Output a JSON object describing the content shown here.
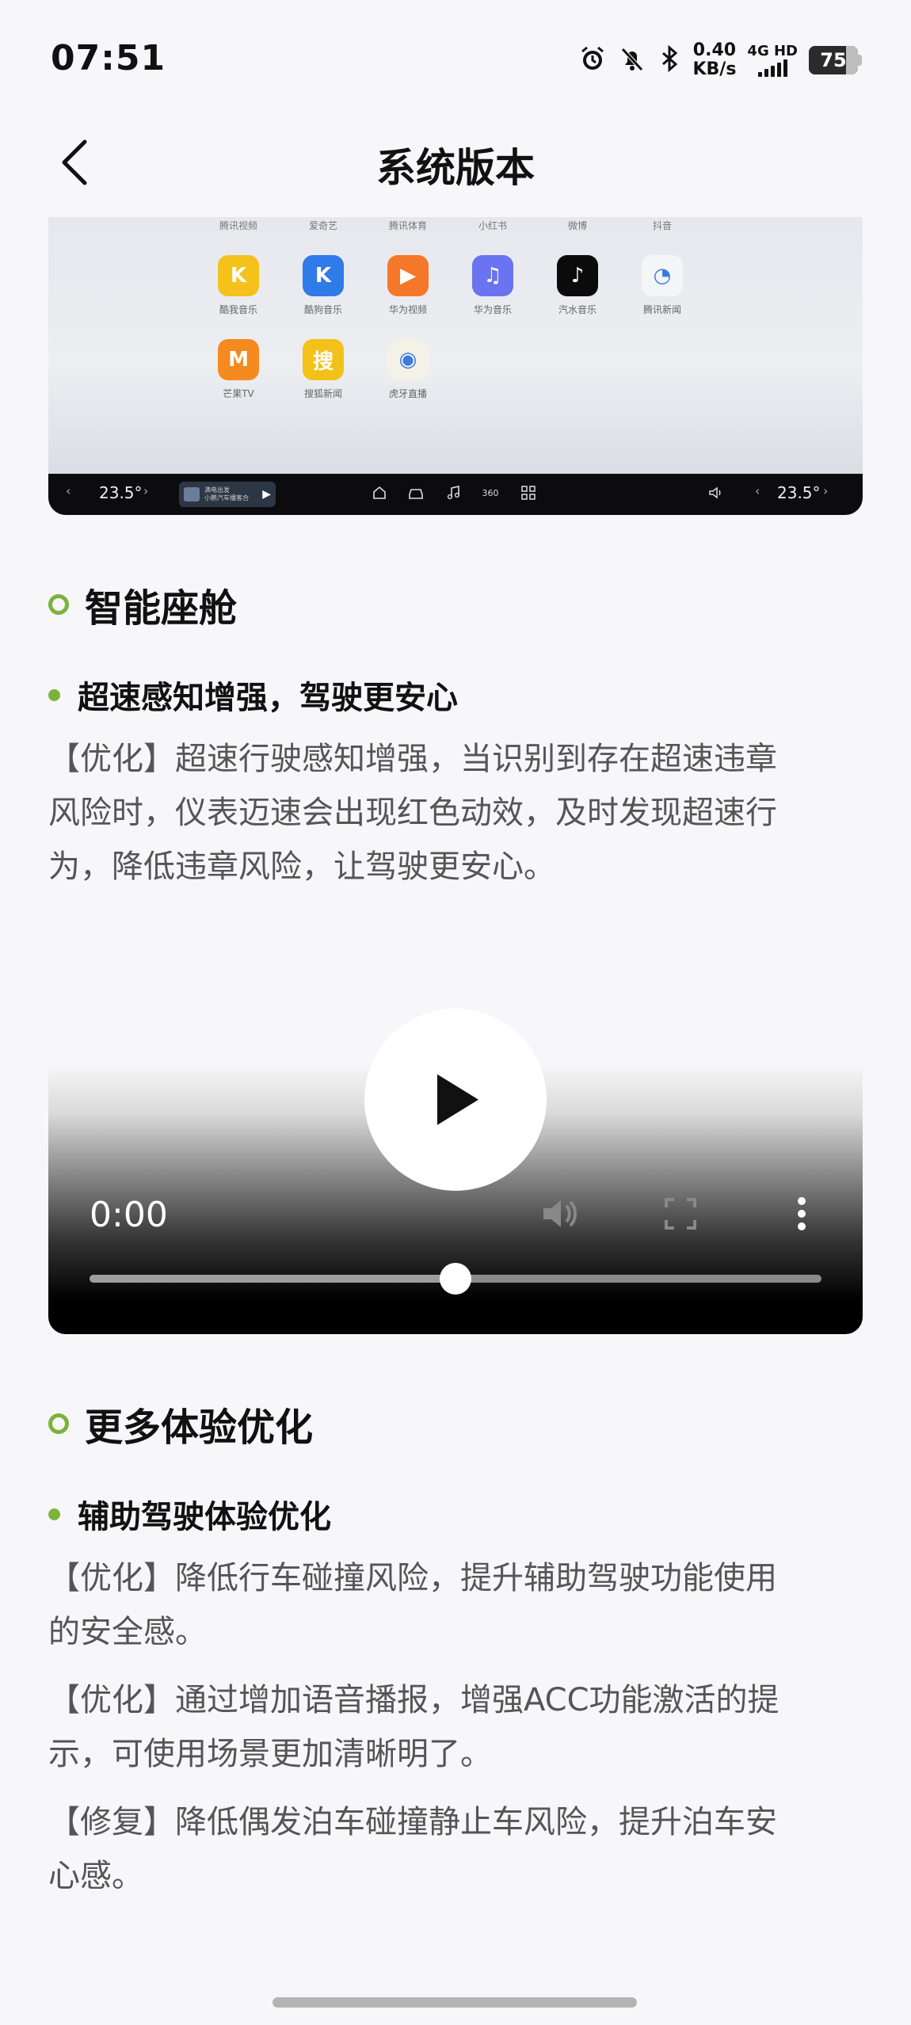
{
  "status_bar": {
    "time": "07:51",
    "net_speed_value": "0.40",
    "net_speed_unit": "KB/s",
    "signal_label": "4G HD",
    "battery": "75",
    "battery_level": 0.75
  },
  "header": {
    "title": "系统版本"
  },
  "car_screenshot": {
    "top_labels": [
      "腾讯视频",
      "爱奇艺",
      "腾讯体育",
      "小红书",
      "微博",
      "抖音"
    ],
    "apps_row1": [
      {
        "label": "酷我音乐",
        "icon": "kuwo-icon",
        "color": "#f5c21b",
        "glyph": "K"
      },
      {
        "label": "酷狗音乐",
        "icon": "kugou-icon",
        "color": "#2f7be8",
        "glyph": "K"
      },
      {
        "label": "华为视频",
        "icon": "huawei-video-icon",
        "color": "#f5772a",
        "glyph": "▶"
      },
      {
        "label": "华为音乐",
        "icon": "huawei-music-icon",
        "color": "#6a73f0",
        "glyph": "♫"
      },
      {
        "label": "汽水音乐",
        "icon": "qishui-icon",
        "color": "#0b0b0b",
        "glyph": "♪"
      },
      {
        "label": "腾讯新闻",
        "icon": "tencent-news-icon",
        "color": "#f4f5f7",
        "glyph": "◔"
      }
    ],
    "apps_row2": [
      {
        "label": "芒果TV",
        "icon": "mango-tv-icon",
        "color": "#f58a20",
        "glyph": "M"
      },
      {
        "label": "搜狐新闻",
        "icon": "sohu-news-icon",
        "color": "#f2c21a",
        "glyph": "搜"
      },
      {
        "label": "虎牙直播",
        "icon": "huya-icon",
        "color": "#f4f1e6",
        "glyph": "◉"
      }
    ],
    "left_temp": "23.5°",
    "right_temp": "23.5°",
    "media_title": "满电出发",
    "media_sub": "小鹏汽车播客合"
  },
  "section1": {
    "title": "智能座舱",
    "item_title": "超速感知增强，驾驶更安心",
    "lines": [
      "【优化】超速行驶感知增强，当识别到存在超速违章",
      "风险时，仪表迈速会出现红色动效，及时发现超速行",
      "为，降低违章风险，让驾驶更安心。"
    ]
  },
  "video": {
    "time": "0:00",
    "progress": 0.5
  },
  "section2": {
    "title": "更多体验优化",
    "item_title": "辅助驾驶体验优化",
    "paras": [
      [
        "【优化】降低行车碰撞风险，提升辅助驾驶功能使用",
        "的安全感。"
      ],
      [
        "【优化】通过增加语音播报，增强ACC功能激活的提",
        "示，可使用场景更加清晰明了。"
      ],
      [
        "【修复】降低偶发泊车碰撞静止车风险，提升泊车安",
        "心感。"
      ]
    ]
  },
  "colors": {
    "accent_green": "#7bb33c",
    "text_main": "#111111",
    "text_body": "#555555",
    "background": "#f7f7f9"
  }
}
